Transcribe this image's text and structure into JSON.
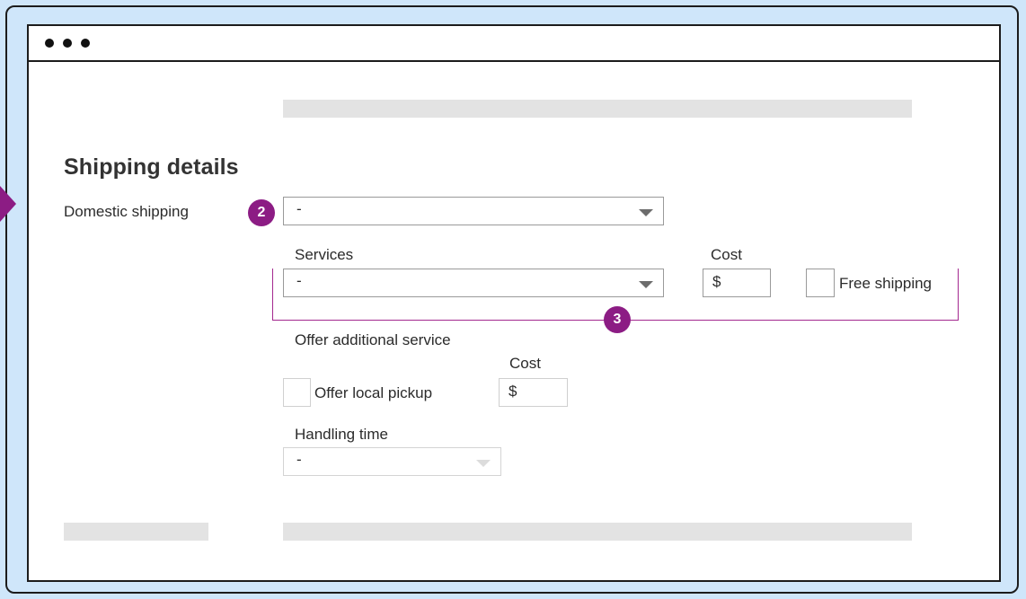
{
  "form": {
    "heading": "Shipping details",
    "domestic_shipping": {
      "label": "Domestic shipping",
      "selected": "-"
    },
    "services": {
      "label": "Services",
      "selected": "-"
    },
    "cost": {
      "label": "Cost",
      "prefix": "$"
    },
    "free_shipping": {
      "label": "Free shipping",
      "checked": false
    },
    "additional_service": {
      "label": "Offer additional service",
      "cost_label": "Cost",
      "cost_prefix": "$",
      "local_pickup_label": "Offer local pickup",
      "local_pickup_checked": false
    },
    "handling_time": {
      "label": "Handling time",
      "selected": "-"
    }
  },
  "callouts": {
    "badge_2": "2",
    "badge_3": "3"
  },
  "colors": {
    "accent": "#8c1c84",
    "frame_background": "#cfe6fa",
    "placeholder": "#e3e3e3"
  },
  "icons": {
    "window_controls": "three-dots-icon",
    "select_caret": "caret-down-icon"
  }
}
